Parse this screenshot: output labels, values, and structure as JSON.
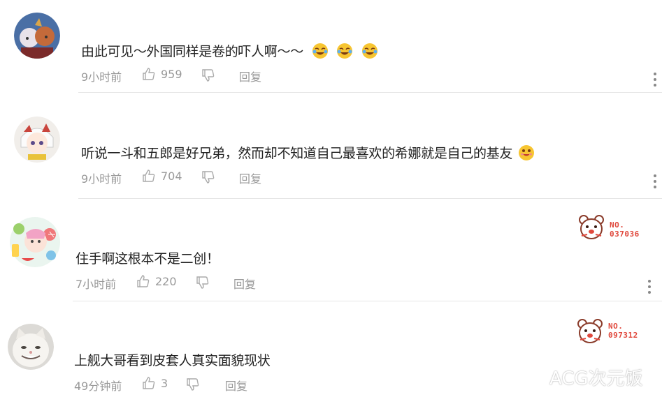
{
  "comments": [
    {
      "text": "由此可见～外国同样是卷的吓人啊～～",
      "time": "9小时前",
      "likes": "959",
      "reply_label": "回复",
      "emojis": [
        "crying-laughing-emoji",
        "crying-laughing-emoji",
        "crying-laughing-emoji"
      ],
      "avatar": "anime-duo-avatar"
    },
    {
      "text": "听说一斗和五郎是好兄弟，然而却不知道自己最喜欢的希娜就是自己的基友",
      "time": "9小时前",
      "likes": "704",
      "reply_label": "回复",
      "emojis": [
        "drooling-emoji"
      ],
      "avatar": "white-hair-anime-girl-avatar"
    },
    {
      "text": "住手啊这根本不是二创！",
      "time": "7小时前",
      "likes": "220",
      "reply_label": "回复",
      "badge": "NO.\n037036",
      "avatar": "summer-fruit-anime-avatar"
    },
    {
      "text": "上舰大哥看到皮套人真实面貌现状",
      "time": "49分钟前",
      "likes": "3",
      "reply_label": "回复",
      "badge": "NO.\n097312",
      "avatar": "smiling-cat-avatar"
    }
  ],
  "watermark": "ACG次元饭",
  "colors": {
    "meta": "#999999",
    "badge": "#e0483c",
    "divider": "#e6e6e6"
  }
}
